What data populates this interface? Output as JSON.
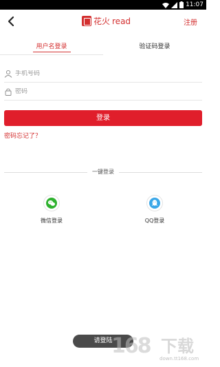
{
  "status_bar": {
    "time": "11:07",
    "icons": [
      "wifi-icon",
      "signal-icon",
      "battery-icon"
    ]
  },
  "header": {
    "back_icon": "chevron-left-icon",
    "brand_cn": "花火",
    "brand_en": "read",
    "register_label": "注册"
  },
  "tabs": [
    {
      "label": "用户名登录",
      "active": true
    },
    {
      "label": "验证码登录",
      "active": false
    }
  ],
  "form": {
    "username": {
      "placeholder": "手机号码",
      "value": "",
      "icon": "user-icon"
    },
    "password": {
      "placeholder": "密码",
      "value": "",
      "icon": "lock-icon"
    },
    "login_label": "登录",
    "forgot_label": "密码忘记了？"
  },
  "quick_login": {
    "divider_label": "一键登录",
    "options": [
      {
        "label": "微信登录",
        "icon": "wechat-icon"
      },
      {
        "label": "QQ登录",
        "icon": "qq-icon"
      }
    ]
  },
  "toast": {
    "text": "请登陆"
  },
  "watermark": {
    "digits": "168",
    "cn": "下载",
    "url": "down.tt168.com"
  },
  "colors": {
    "accent": "#e01e2b",
    "brand": "#d32f2f",
    "wechat": "#2fb12f",
    "qq": "#3aa7e8"
  }
}
